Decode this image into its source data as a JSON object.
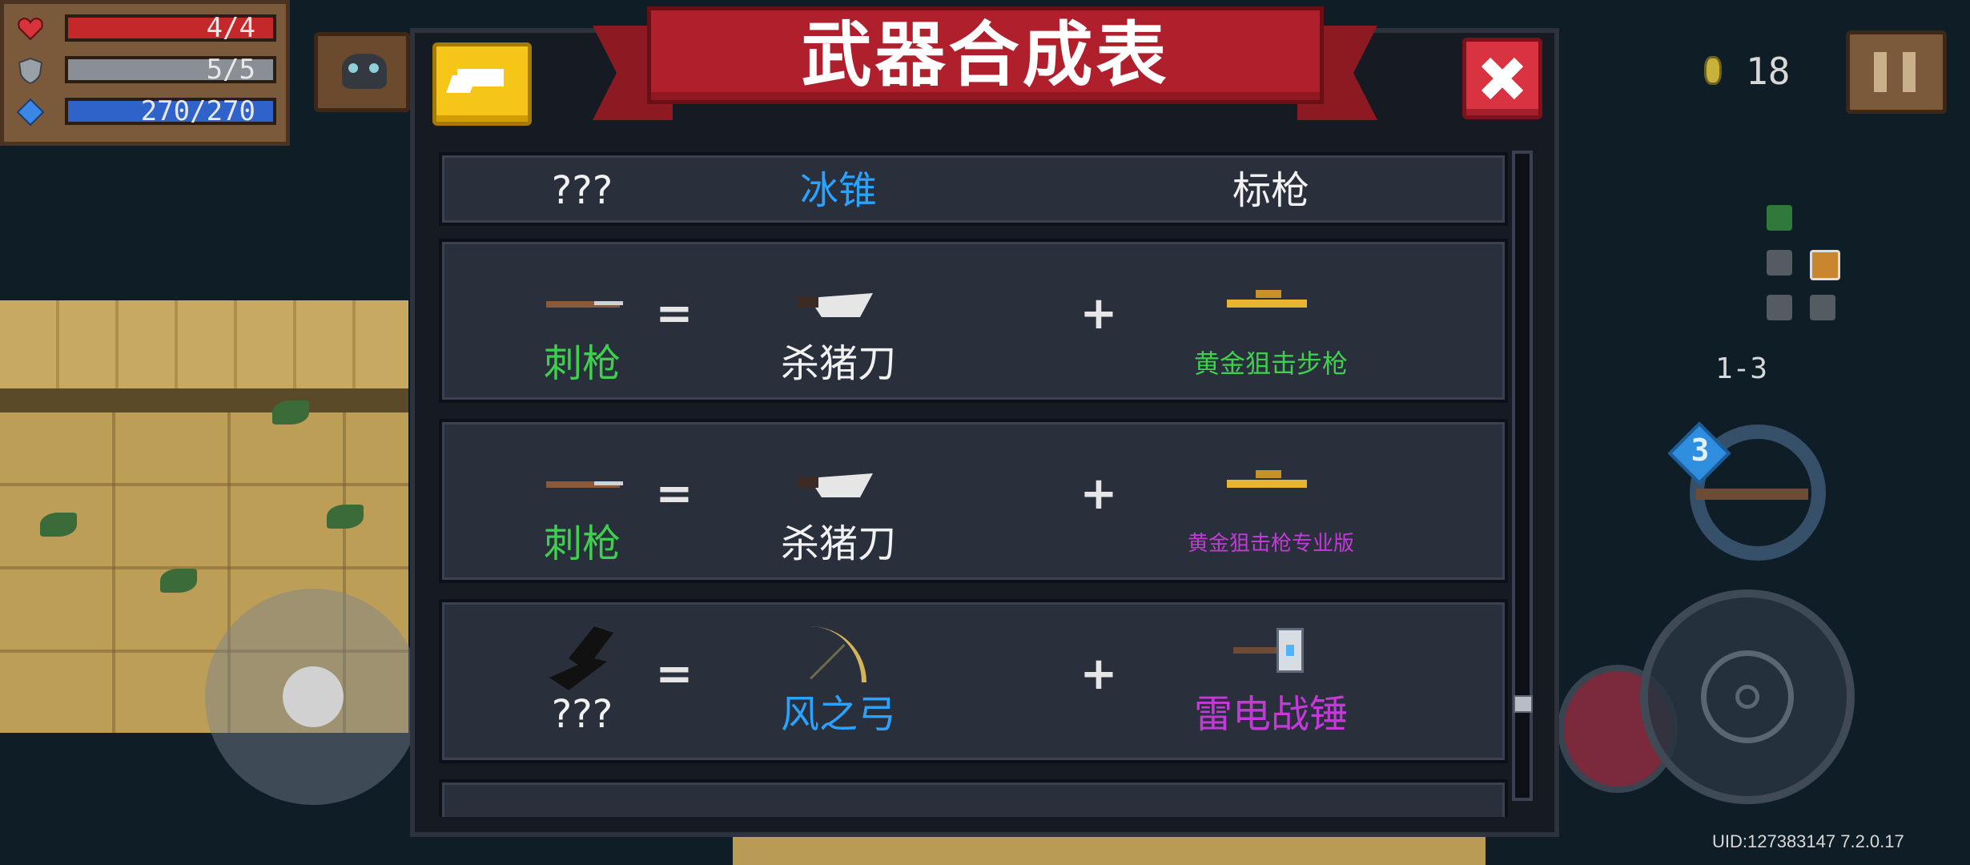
{
  "hud": {
    "hp": "4/4",
    "armor": "5/5",
    "energy": "270/270",
    "coins": "18",
    "level": "1-3",
    "weapon_energy_cost": "3",
    "uid": "UID:127383147 7.2.0.17"
  },
  "dialog": {
    "title": "武器合成表",
    "back_icon": "back-arrow-icon",
    "close_icon": "close-x-icon"
  },
  "recipes": [
    {
      "result": {
        "name": "???",
        "color": "#f2f2f2"
      },
      "ingredient1": {
        "name": "冰锥",
        "color": "#2aa3ff"
      },
      "ingredient2": {
        "name": "标枪",
        "color": "#f2f2f2"
      }
    },
    {
      "result": {
        "name": "刺枪",
        "icon": "bayonet-gun-icon",
        "color": "#3fcf4f"
      },
      "ingredient1": {
        "name": "杀猪刀",
        "icon": "butcher-knife-icon",
        "color": "#f2f2f2"
      },
      "ingredient2": {
        "name": "黄金狙击步枪",
        "icon": "golden-sniper-rifle-icon",
        "color": "#3fcf4f"
      }
    },
    {
      "result": {
        "name": "刺枪",
        "icon": "bayonet-gun-icon",
        "color": "#3fcf4f"
      },
      "ingredient1": {
        "name": "杀猪刀",
        "icon": "butcher-knife-icon",
        "color": "#f2f2f2"
      },
      "ingredient2": {
        "name": "黄金狙击枪专业版",
        "icon": "golden-sniper-pro-icon",
        "color": "#c43ad8"
      }
    },
    {
      "result": {
        "name": "???",
        "icon": "dark-wing-icon",
        "color": "#f2f2f2"
      },
      "ingredient1": {
        "name": "风之弓",
        "icon": "wind-bow-icon",
        "color": "#2aa3ff"
      },
      "ingredient2": {
        "name": "雷电战锤",
        "icon": "thunder-hammer-icon",
        "color": "#c43ad8"
      }
    }
  ],
  "symbols": {
    "equals": "=",
    "plus": "+"
  }
}
